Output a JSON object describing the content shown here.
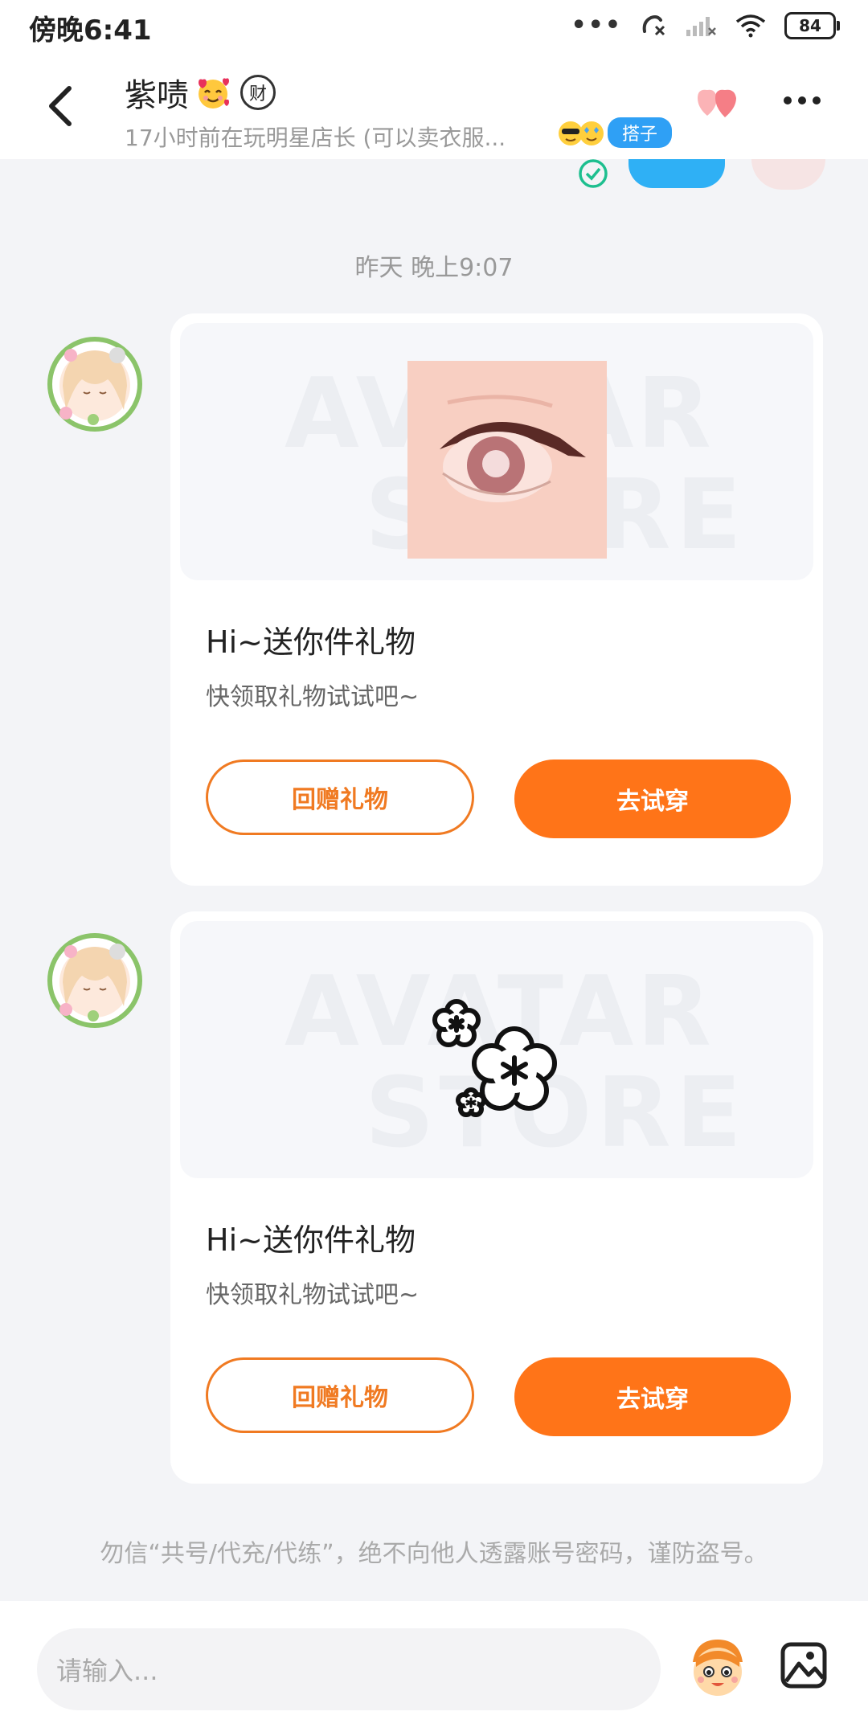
{
  "status_bar": {
    "time": "傍晚6:41",
    "battery": "84"
  },
  "header": {
    "title": "紫啧",
    "badge": "财",
    "subtitle": "17小时前在玩明星店长 (可以卖衣服...",
    "tag": "搭子"
  },
  "chat": {
    "timestamp": "昨天 晚上9:07",
    "messages": [
      {
        "title": "Hi~送你件礼物",
        "desc": "快领取礼物试试吧~",
        "btn_return": "回赠礼物",
        "btn_try": "去试穿",
        "watermark_top": "AVATAR",
        "watermark_bottom": "STORE"
      },
      {
        "title": "Hi~送你件礼物",
        "desc": "快领取礼物试试吧~",
        "btn_return": "回赠礼物",
        "btn_try": "去试穿",
        "watermark_top": "AVATAR",
        "watermark_bottom": "STORE"
      }
    ],
    "warning": "勿信“共号/代充/代练”，绝不向他人透露账号密码，谨防盗号。"
  },
  "input_bar": {
    "placeholder": "请输入..."
  },
  "colors": {
    "accent": "#ff7418",
    "blue": "#2fa0f5",
    "bg": "#f3f4f7"
  }
}
